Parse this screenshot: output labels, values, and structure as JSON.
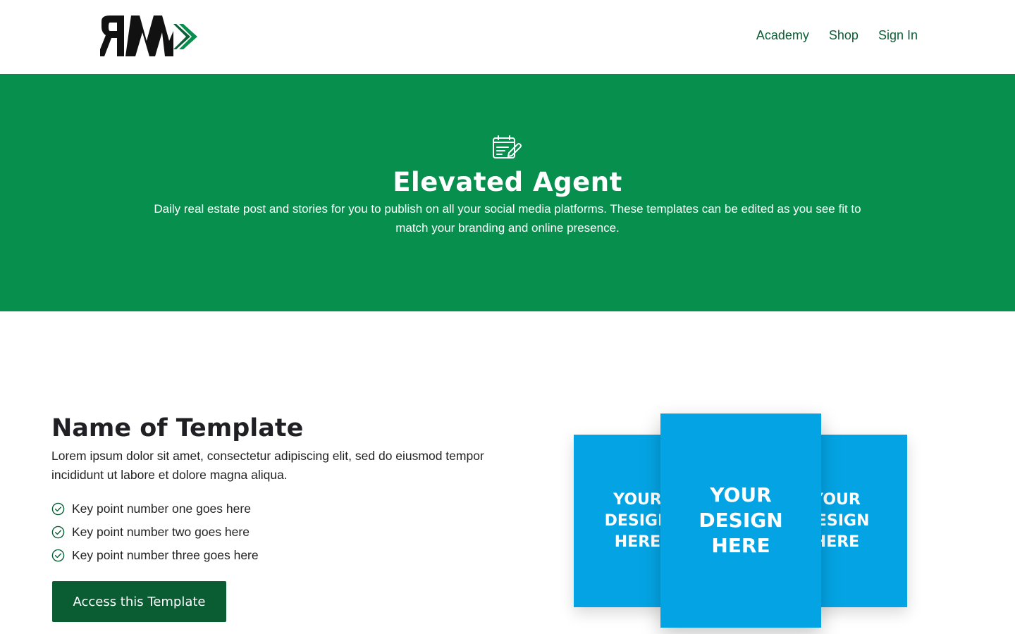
{
  "header": {
    "logo_alt": "RM",
    "nav": [
      {
        "label": "Academy"
      },
      {
        "label": "Shop"
      },
      {
        "label": "Sign In"
      }
    ]
  },
  "hero": {
    "icon": "calendar-edit-icon",
    "title": "Elevated Agent",
    "subtitle": "Daily real estate post and stories for you to publish on all your social media platforms. These templates can be edited as you see fit to match your branding and online presence."
  },
  "template": {
    "title": "Name of Template",
    "description": "Lorem ipsum dolor sit amet, consectetur adipiscing elit, sed do eiusmod tempor incididunt ut labore et dolore magna aliqua.",
    "points": [
      "Key point number one goes here",
      "Key point number two goes here",
      "Key point number three goes here"
    ],
    "cta_label": "Access this Template"
  },
  "mockup": {
    "cards": [
      {
        "line1": "YOUR",
        "line2": "DESIGN",
        "line3": "HERE"
      },
      {
        "line1": "YOUR",
        "line2": "DESIGN",
        "line3": "HERE"
      },
      {
        "line1": "YOUR",
        "line2": "DESIGN",
        "line3": "HERE"
      }
    ]
  },
  "colors": {
    "brand_green": "#078f4e",
    "button_green": "#0a5c33",
    "nav_green": "#0b5e35",
    "mockup_blue": "#04a4e4"
  }
}
